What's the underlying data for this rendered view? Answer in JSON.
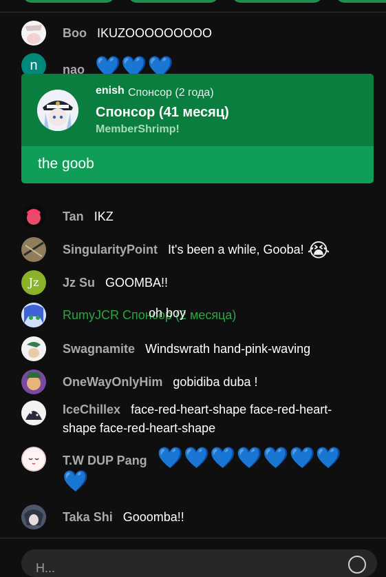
{
  "messages": [
    {
      "author": "Boo",
      "text": "IKUZOOOOOOOOO"
    },
    {
      "author": "nao",
      "avatar_letter": "n",
      "text": "💙💙💙"
    },
    {
      "author": "Tan",
      "text": "IKZ"
    },
    {
      "author": "SingularityPoint",
      "text": "It's been a while, Gooba!",
      "emoji": "😭"
    },
    {
      "author": "Jz Su",
      "avatar_letter": "Jz",
      "text": "GOOMBA!!"
    },
    {
      "author": "RumyJCR",
      "badge": "Спонсор (2 месяца)",
      "text": "oh boy"
    },
    {
      "author": "Swagnamite",
      "text": "Windswrath",
      "text2": "hand-pink-waving"
    },
    {
      "author": "OneWayOnlyHim",
      "text": "gobidiba duba !"
    },
    {
      "author": "IceChillex",
      "text": "face-red-heart-shape face-red-heart-",
      "text2": "shape face-red-heart-shape"
    },
    {
      "author": "T.W DUP Pang",
      "text": "💙💙💙💙💙💙💙",
      "text2": "💙"
    },
    {
      "author": "Taka Shi",
      "text": "Gooomba!!"
    }
  ],
  "member": {
    "name": "enish",
    "duration": "Спонсор (2 года)",
    "title": "Спонсор (41 месяц)",
    "subtitle": "MemberShrimp!",
    "message": "the goob"
  },
  "input": {
    "text": "H..."
  },
  "colors": {
    "accent": "#0f9d58",
    "heart": "#2a7fff",
    "sponsor_green": "#2ba640"
  }
}
